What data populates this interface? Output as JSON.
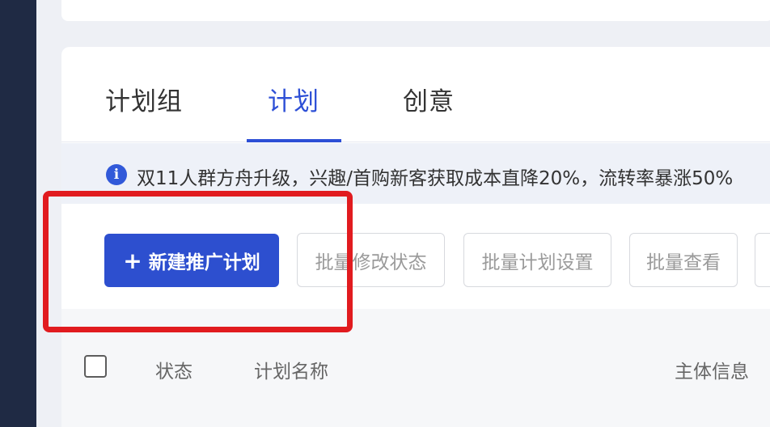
{
  "tabs": [
    {
      "label": "计划组",
      "active": false
    },
    {
      "label": "计划",
      "active": true
    },
    {
      "label": "创意",
      "active": false
    }
  ],
  "notice": {
    "icon": "info-icon",
    "text": "双11人群方舟升级，兴趣/首购新客获取成本直降20%，流转率暴涨50%"
  },
  "actions": {
    "new_plan": "新建推广计划",
    "plus_icon": "plus-icon",
    "batch_status": "批量修改状态",
    "batch_settings": "批量计划设置",
    "batch_view": "批量查看",
    "more": "批"
  },
  "table": {
    "headers": [
      "状态",
      "计划名称",
      "主体信息"
    ]
  },
  "colors": {
    "accent": "#2d4fd6",
    "primary_button": "#2d4fcf",
    "highlight_frame": "#e11b1f",
    "sidebar": "#1f2a44"
  }
}
